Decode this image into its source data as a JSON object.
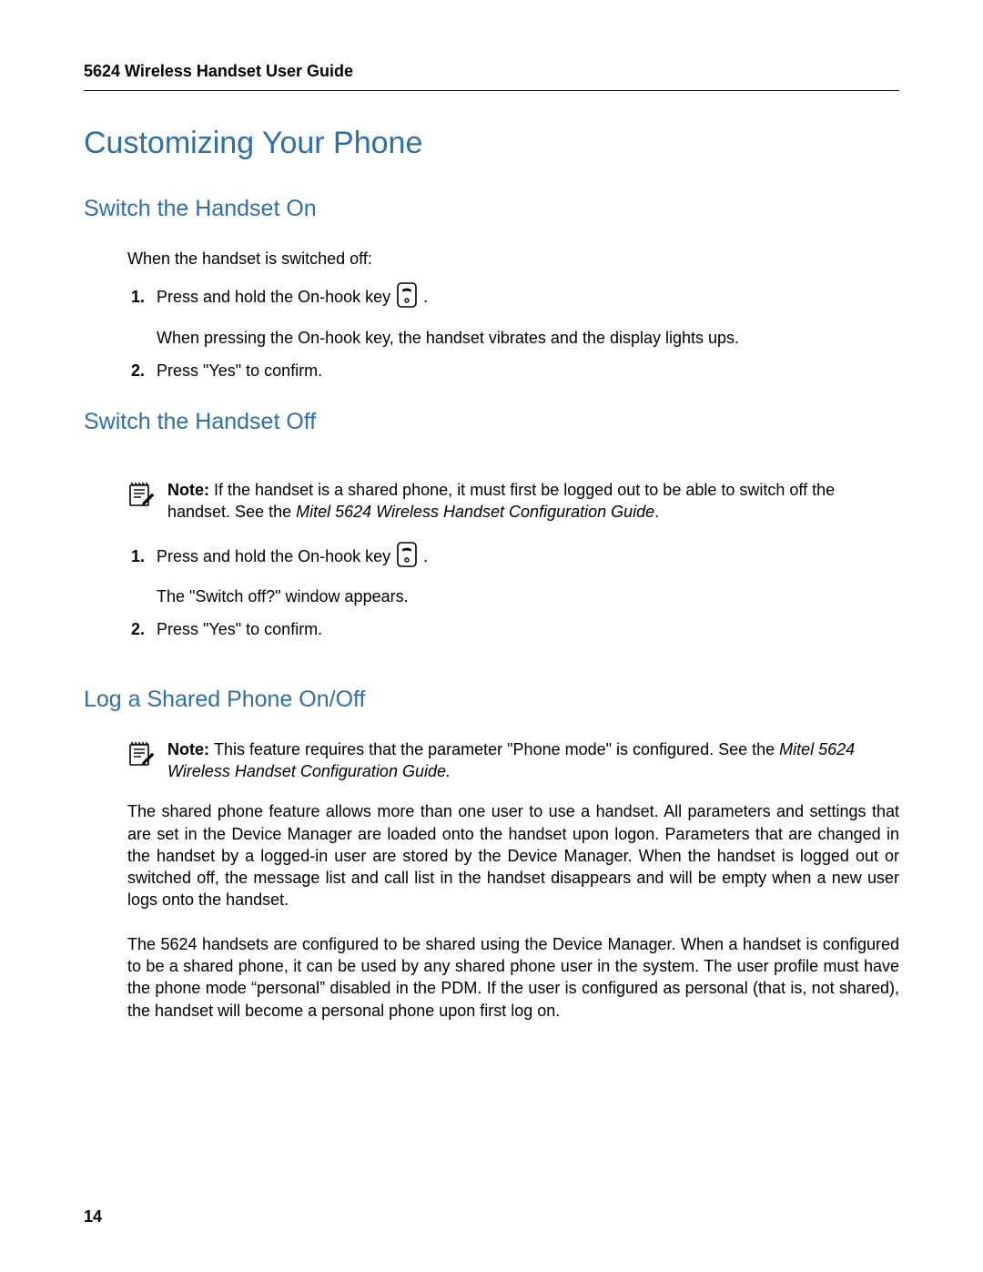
{
  "header": {
    "running": "5624 Wireless Handset User Guide"
  },
  "chapter": {
    "title": "Customizing Your Phone"
  },
  "section1": {
    "title": "Switch the Handset On",
    "intro": "When the handset is switched off:",
    "step1_pre": "Press and hold the On-hook key ",
    "step1_post": " .",
    "step1_sub": "When pressing the On-hook key, the handset vibrates and the display lights ups.",
    "step2": "Press  \"Yes\" to confirm."
  },
  "section2": {
    "title": "Switch the Handset Off",
    "note_label": "Note: ",
    "note_body": "If the handset is a shared phone, it must first be logged out to be able to switch off the handset. See the ",
    "note_italic": "Mitel 5624 Wireless Handset Configuration Guide",
    "note_end": ".",
    "step1_pre": "Press and hold the On-hook key ",
    "step1_post": " .",
    "step1_sub": "The \"Switch off?\" window appears.",
    "step2": "Press \"Yes\" to confirm."
  },
  "section3": {
    "title": "Log a Shared Phone On/Off",
    "note_label": "Note: ",
    "note_body": "This feature requires that the parameter \"Phone mode\" is configured. See the ",
    "note_italic": "Mitel 5624 Wireless Handset Configuration Guide.",
    "para1": "The shared phone feature allows more than one user to use a handset. All parameters and settings that are set in the Device Manager are loaded onto the handset upon logon. Parameters that are changed in the handset by a logged-in user are stored by the Device Manager. When the handset is logged out or switched off, the message list and call list in the handset disappears and will be empty when a new user logs onto the handset.",
    "para2": "The 5624 handsets are configured to be shared using the Device Manager. When a handset is configured to be a shared phone, it can be used by any shared phone user in the system. The user profile must have the phone mode “personal” disabled in the PDM. If the user is configured as personal (that is, not shared), the handset will become a personal phone upon first log on."
  },
  "page_number": "14"
}
